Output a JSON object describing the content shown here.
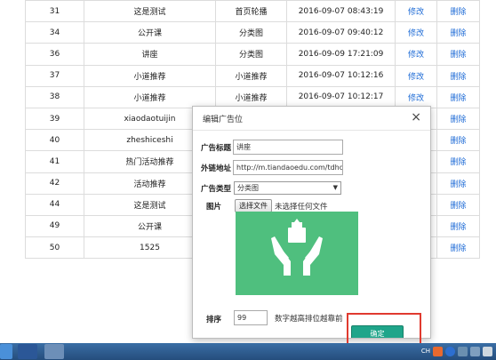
{
  "table": {
    "rows": [
      {
        "id": "31",
        "title": "这是测试",
        "type": "首页轮播",
        "time": "2016-09-07 08:43:19",
        "edit": "修改",
        "del": "删除"
      },
      {
        "id": "34",
        "title": "公开课",
        "type": "分类图",
        "time": "2016-09-07 09:40:12",
        "edit": "修改",
        "del": "删除"
      },
      {
        "id": "36",
        "title": "讲座",
        "type": "分类图",
        "time": "2016-09-09 17:21:09",
        "edit": "修改",
        "del": "删除"
      },
      {
        "id": "37",
        "title": "小道推荐",
        "type": "小道推荐",
        "time": "2016-09-07 10:12:16",
        "edit": "修改",
        "del": "删除"
      },
      {
        "id": "38",
        "title": "小道推荐",
        "type": "小道推荐",
        "time": "2016-09-07 10:12:17",
        "edit": "修改",
        "del": "删除"
      },
      {
        "id": "39",
        "title": "xiaodaotuijin",
        "type": "",
        "time": "",
        "edit": "",
        "del": "删除"
      },
      {
        "id": "40",
        "title": "zheshiceshi",
        "type": "",
        "time": "",
        "edit": "",
        "del": "删除"
      },
      {
        "id": "41",
        "title": "热门活动推荐",
        "type": "",
        "time": "",
        "edit": "",
        "del": "删除"
      },
      {
        "id": "42",
        "title": "活动推荐",
        "type": "",
        "time": "",
        "edit": "",
        "del": "删除"
      },
      {
        "id": "44",
        "title": "这是测试",
        "type": "",
        "time": "",
        "edit": "",
        "del": "删除"
      },
      {
        "id": "49",
        "title": "公开课",
        "type": "",
        "time": "",
        "edit": "",
        "del": "删除"
      },
      {
        "id": "50",
        "title": "1525",
        "type": "",
        "time": "",
        "edit": "",
        "del": "删除"
      }
    ]
  },
  "modal": {
    "title": "编辑广告位",
    "close": "×",
    "title_label": "广告标题",
    "title_value": "讲座",
    "url_label": "外链地址",
    "url_value": "http://m.tiandaoedu.com/tdhd/",
    "type_label": "广告类型",
    "type_value": "分类图",
    "type_arrow": "▼",
    "image_label": "图片",
    "file_button": "选择文件",
    "file_status": "未选择任何文件",
    "sort_label": "排序",
    "sort_value": "99",
    "sort_note": "数字越高排位越靠前",
    "submit_label": "确定"
  },
  "colors": {
    "link": "#1e6bd6",
    "submit": "#1fa58a",
    "preview_bg": "#4fbf7e",
    "highlight_box": "#e03a2f"
  },
  "taskbar": {
    "tray_lang": "CH",
    "icons": [
      "start-orb-icon",
      "word-icon",
      "app-icon",
      "ime-icon",
      "help-icon",
      "network-icon",
      "volume-icon",
      "security-icon"
    ]
  }
}
